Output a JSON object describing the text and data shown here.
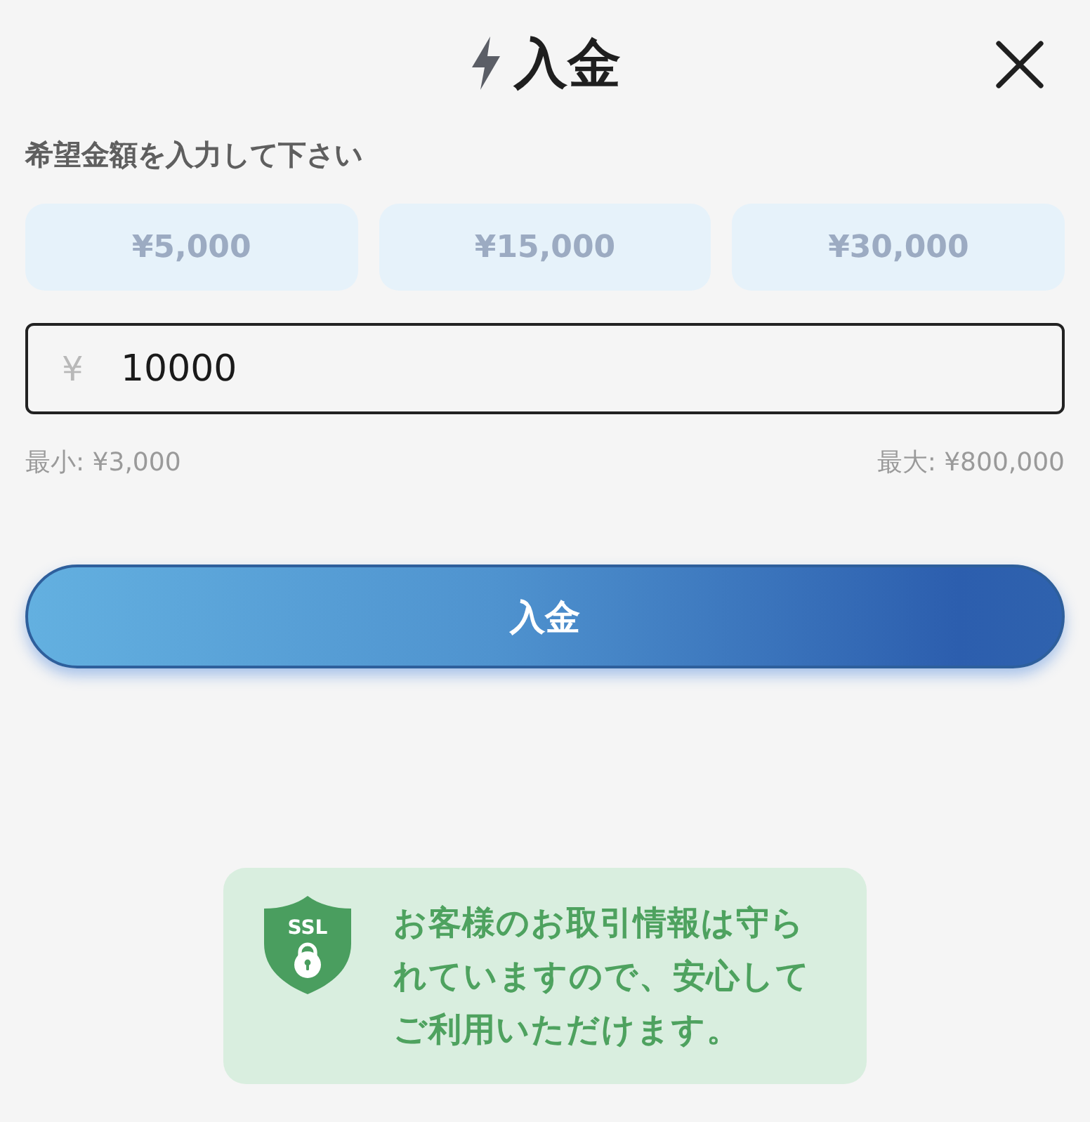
{
  "header": {
    "title": "入金"
  },
  "amount_prompt": "希望金額を入力して下さい",
  "presets": [
    {
      "label": "¥5,000",
      "selected": false
    },
    {
      "label": "¥15,000",
      "selected": false
    },
    {
      "label": "¥30,000",
      "selected": false
    }
  ],
  "amount_field": {
    "currency": "¥",
    "value": "10000"
  },
  "limits": {
    "min": "最小: ¥3,000",
    "max": "最大: ¥800,000"
  },
  "submit_button": "入金",
  "security_notice": {
    "badge": "SSL",
    "text": "お客様のお取引情報は守られていますので、安心してご利用いただけます。"
  }
}
